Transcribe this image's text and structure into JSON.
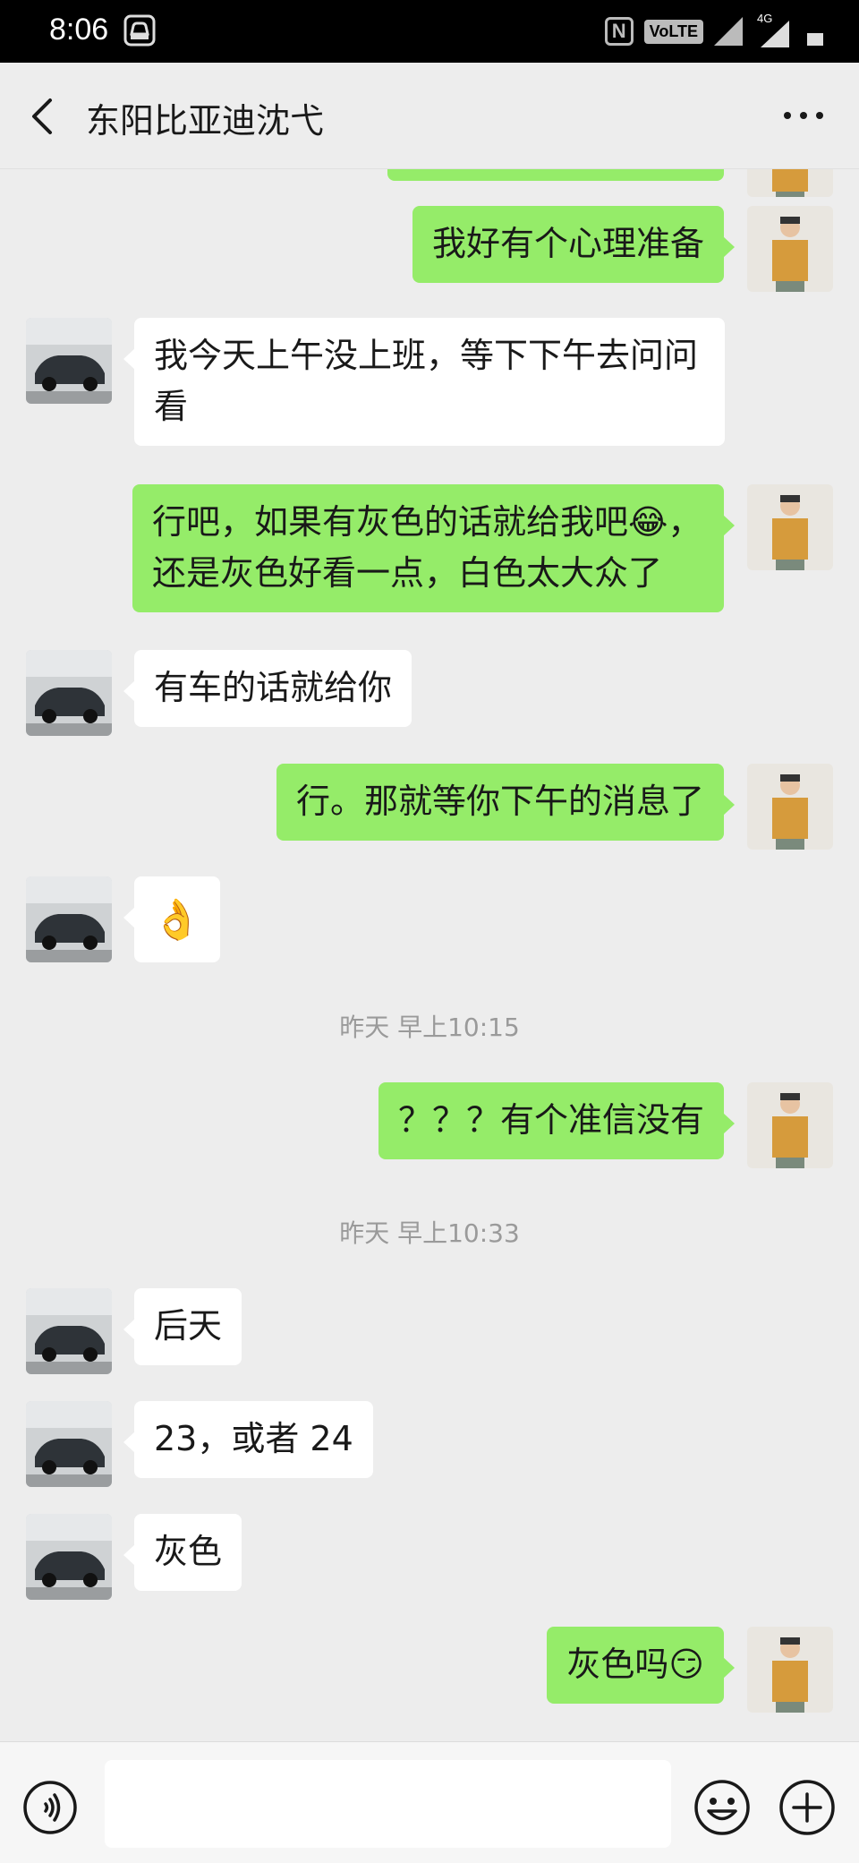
{
  "status_bar": {
    "time": "8:06",
    "nfc": "N",
    "volte": "VoLTE",
    "network": "4G"
  },
  "header": {
    "title": "东阳比亚迪沈弋",
    "back_icon": "chevron-left-icon",
    "more_icon": "more-dots-icon"
  },
  "messages": [
    {
      "side": "out",
      "text": ""
    },
    {
      "side": "out",
      "text": "我好有个心理准备"
    },
    {
      "side": "in",
      "text": "我今天上午没上班，等下下午去问问看"
    },
    {
      "side": "out",
      "text": "行吧，如果有灰色的话就给我吧😂，还是灰色好看一点，白色太大众了"
    },
    {
      "side": "in",
      "text": "有车的话就给你"
    },
    {
      "side": "out",
      "text": "行。那就等你下午的消息了"
    },
    {
      "side": "in",
      "text": "👌",
      "emoji": "ok-hand-emoji"
    },
    {
      "timestamp": "昨天 早上10:15"
    },
    {
      "side": "out",
      "text": "？？？有个准信没有"
    },
    {
      "timestamp": "昨天 早上10:33"
    },
    {
      "side": "in",
      "text": "后天"
    },
    {
      "side": "in",
      "text": "23，或者 24"
    },
    {
      "side": "in",
      "text": "灰色"
    },
    {
      "side": "out",
      "text": "灰色吗😏"
    }
  ],
  "colors": {
    "background": "#ededed",
    "bubble_out": "#95ec69",
    "bubble_in": "#ffffff",
    "timestamp": "#9a9a9a"
  },
  "bottom_bar": {
    "input_value": "",
    "voice_icon": "voice-icon",
    "emoji_icon": "smiley-icon",
    "plus_icon": "plus-icon"
  }
}
